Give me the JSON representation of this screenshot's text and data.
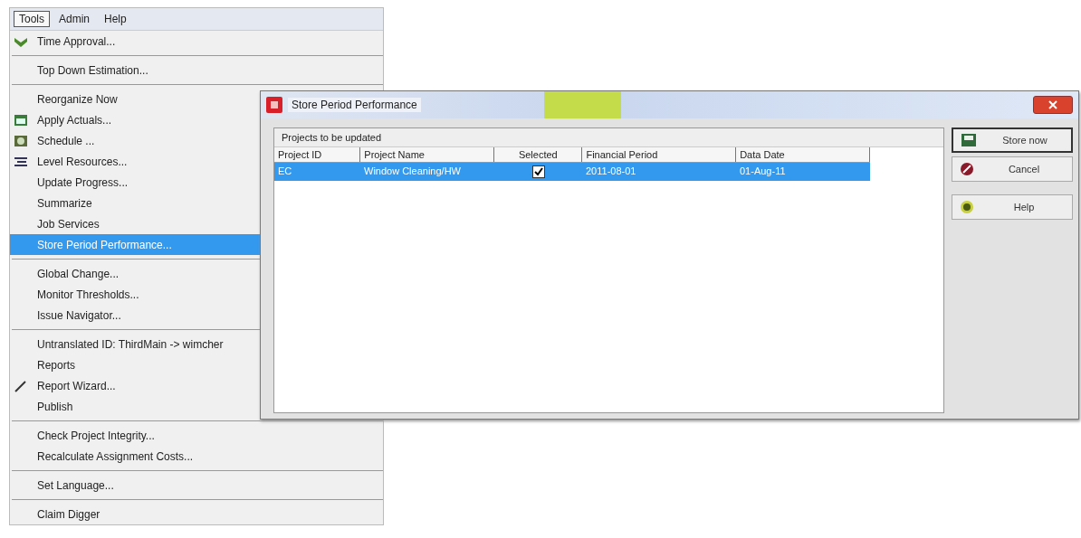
{
  "menu_bar": [
    {
      "label": "Tools",
      "selected": true
    },
    {
      "label": "Admin",
      "selected": false
    },
    {
      "label": "Help",
      "selected": false
    }
  ],
  "menu": {
    "items": [
      {
        "kind": "item",
        "label": "Time Approval...",
        "selected": false
      },
      {
        "kind": "separator"
      },
      {
        "kind": "item",
        "label": "Top Down Estimation...",
        "selected": false
      },
      {
        "kind": "separator"
      },
      {
        "kind": "item",
        "label": "Reorganize Now",
        "selected": false
      },
      {
        "kind": "item",
        "label": "Apply Actuals...",
        "selected": false
      },
      {
        "kind": "item",
        "label": "Schedule ...",
        "selected": false
      },
      {
        "kind": "item",
        "label": "Level Resources...",
        "selected": false
      },
      {
        "kind": "item",
        "label": "Update Progress...",
        "selected": false
      },
      {
        "kind": "item",
        "label": "Summarize",
        "selected": false
      },
      {
        "kind": "item",
        "label": "Job Services",
        "selected": false
      },
      {
        "kind": "item",
        "label": "Store Period Performance...",
        "selected": true
      },
      {
        "kind": "separator"
      },
      {
        "kind": "item",
        "label": "Global Change...",
        "selected": false
      },
      {
        "kind": "item",
        "label": "Monitor Thresholds...",
        "selected": false
      },
      {
        "kind": "item",
        "label": "Issue Navigator...",
        "selected": false
      },
      {
        "kind": "separator"
      },
      {
        "kind": "item",
        "label": "Untranslated ID: ThirdMain -> wimcher",
        "selected": false
      },
      {
        "kind": "item",
        "label": "Reports",
        "selected": false
      },
      {
        "kind": "item",
        "label": "Report Wizard...",
        "selected": false
      },
      {
        "kind": "item",
        "label": "Publish",
        "selected": false
      },
      {
        "kind": "separator"
      },
      {
        "kind": "item",
        "label": "Check Project Integrity...",
        "selected": false
      },
      {
        "kind": "item",
        "label": "Recalculate Assignment Costs...",
        "selected": false
      },
      {
        "kind": "separator"
      },
      {
        "kind": "item",
        "label": "Set Language...",
        "selected": false
      },
      {
        "kind": "separator"
      },
      {
        "kind": "item",
        "label": "Claim Digger",
        "selected": false
      }
    ]
  },
  "dialog": {
    "title": "Store Period Performance",
    "group_label": "Projects to be updated",
    "table": {
      "columns": [
        "Project ID",
        "Project Name",
        "Selected",
        "Financial Period",
        "Data Date"
      ],
      "rows": [
        {
          "project_id": "EC",
          "project_name": "Window Cleaning/HW",
          "checked": true,
          "financial_period": "2011-08-01",
          "data_date": "01-Aug-11",
          "selected": true
        }
      ]
    },
    "buttons": [
      {
        "label": "Store now",
        "kind": "store",
        "default": true
      },
      {
        "label": "Cancel",
        "kind": "cancel",
        "default": false
      },
      {
        "label": "Help",
        "kind": "help",
        "default": false
      }
    ]
  }
}
